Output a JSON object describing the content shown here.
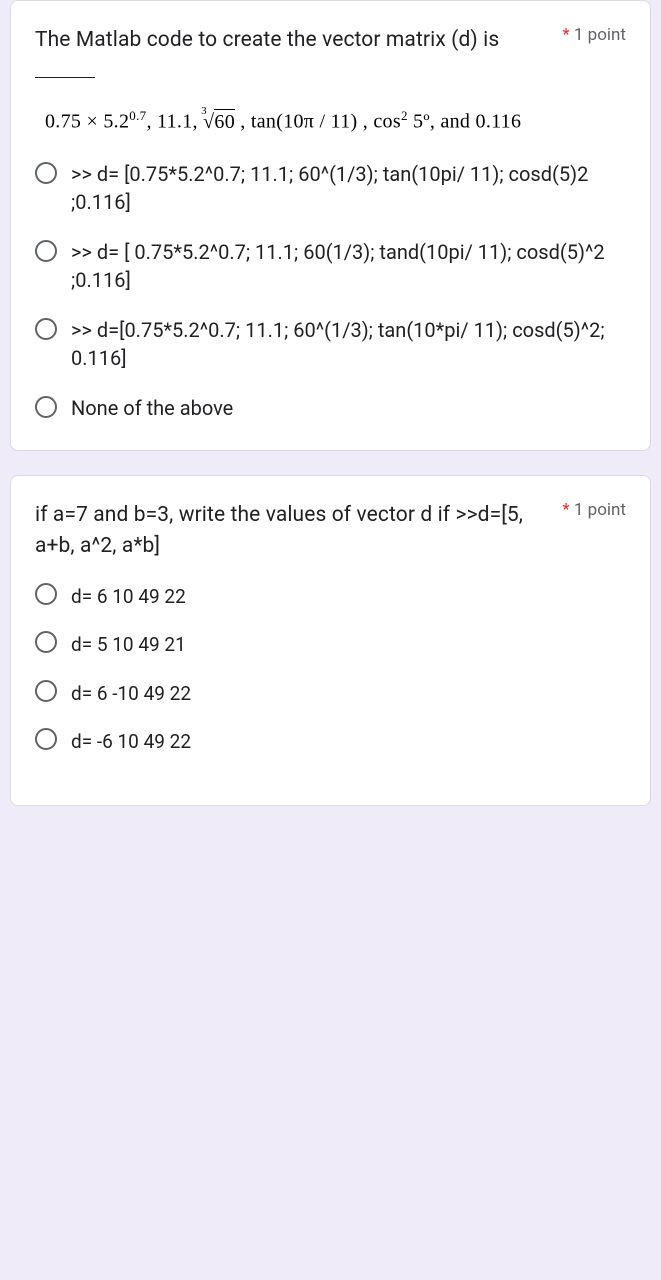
{
  "question1": {
    "text_line1": "The Matlab code to create the",
    "text_line2": "vector matrix (d) is",
    "points": "1 point",
    "formula": "0.75 × 5.2⁰·⁷, 11.1, ∛60 , tan(10π / 11) , cos² 5º, and 0.116",
    "options": [
      ">> d= [0.75*5.2^0.7; 11.1; 60^(1/3); tan(10pi/ 11); cosd(5)2 ;0.116]",
      ">> d= [ 0.75*5.2^0.7; 11.1; 60(1/3); tand(10pi/ 11); cosd(5)^2 ;0.116]",
      ">> d=[0.75*5.2^0.7; 11.1; 60^(1/3); tan(10*pi/ 11); cosd(5)^2; 0.116]",
      "None of the above"
    ]
  },
  "question2": {
    "text_line1": "if a=7 and b=3, write the values",
    "text_line2": "of vector d if    >>d=[5, a+b,",
    "text_line3": "a^2, a*b]",
    "points": "1 point",
    "options": [
      "d= 6 10 49 22",
      "d= 5 10 49 21",
      "d= 6 -10 49 22",
      "d= -6 10 49 22"
    ]
  }
}
